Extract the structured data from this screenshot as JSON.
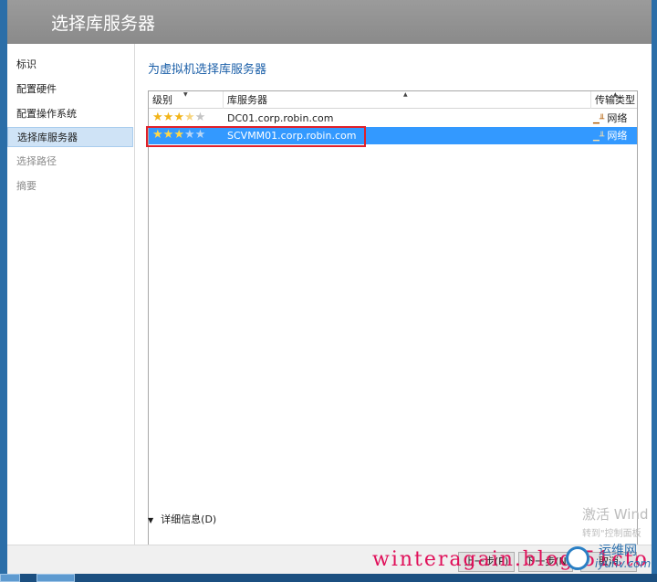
{
  "window": {
    "title": "选择库服务器"
  },
  "sidebar": {
    "items": [
      {
        "label": "标识",
        "state": "normal"
      },
      {
        "label": "配置硬件",
        "state": "normal"
      },
      {
        "label": "配置操作系统",
        "state": "normal"
      },
      {
        "label": "选择库服务器",
        "state": "active"
      },
      {
        "label": "选择路径",
        "state": "disabled"
      },
      {
        "label": "摘要",
        "state": "disabled"
      }
    ]
  },
  "main": {
    "heading": "为虚拟机选择库服务器",
    "columns": {
      "rating": "级别",
      "server": "库服务器",
      "transport": "传输类型"
    },
    "rows": [
      {
        "rating": 3.5,
        "server": "DC01.corp.robin.com",
        "transport": "网络",
        "selected": false
      },
      {
        "rating": 3,
        "server": "SCVMM01.corp.robin.com",
        "transport": "网络",
        "selected": true
      }
    ],
    "details_label": "详细信息(D)"
  },
  "footer": {
    "prev_label": "上一步(P)",
    "next_label": "下一步(N",
    "cancel_label": "取消"
  },
  "watermarks": {
    "activate_line1": "激活 Wind",
    "activate_line2": "转到\"控制面板",
    "blog": "winteragain.blog.51cto",
    "site_cn": "运维网",
    "site_en": "iyunv.com"
  },
  "colors": {
    "selection": "#3399ff",
    "heading": "#1b5fa8",
    "highlight_box": "#e0202a",
    "star": "#f2b418"
  }
}
